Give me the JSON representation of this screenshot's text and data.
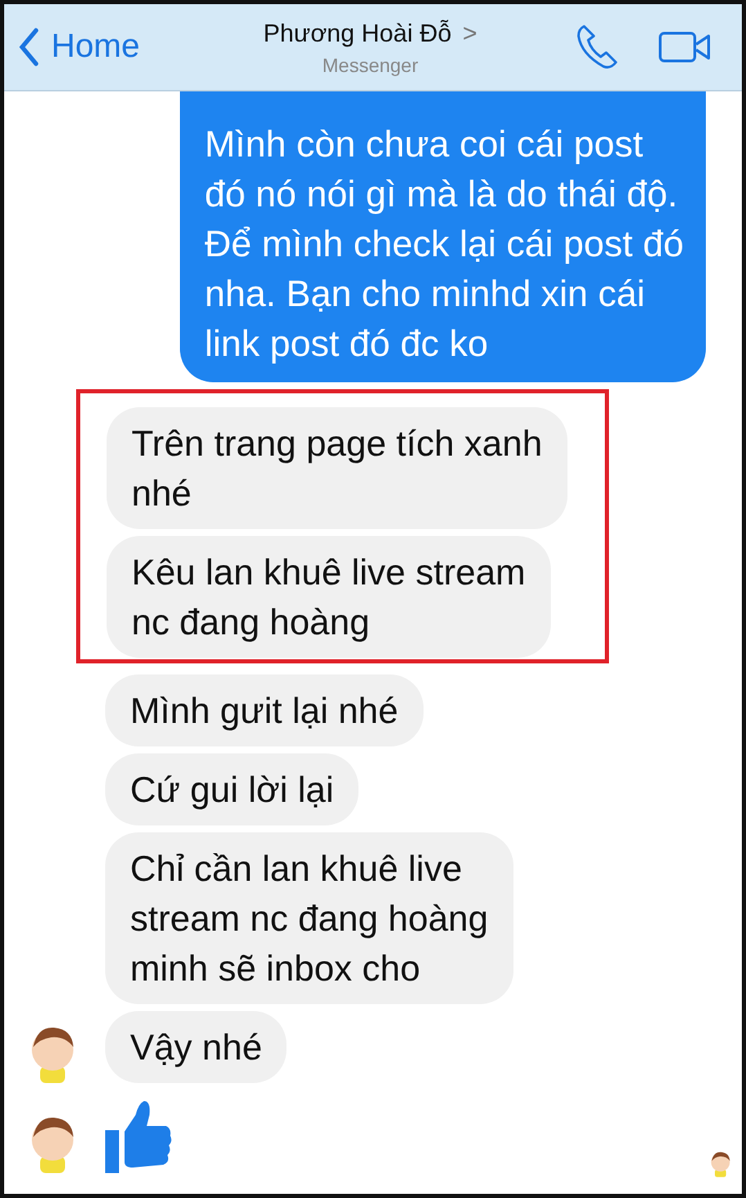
{
  "header": {
    "back": "Home",
    "title": "Phương Hoài Đỗ",
    "title_chevron": ">",
    "subtitle": "Messenger"
  },
  "messages": [
    {
      "kind": "sent",
      "lines": [
        "Mình còn chưa coi cái post",
        "đó nó nói gì mà là do thái độ.",
        "Để mình check lại cái post đó",
        "nha. Bạn cho minhd xin cái",
        "link post đó đc ko"
      ],
      "highlighted": false,
      "avatar": false
    },
    {
      "kind": "received",
      "lines": [
        "Trên trang page tích xanh",
        "nhé"
      ],
      "highlighted": true,
      "avatar": false
    },
    {
      "kind": "received",
      "lines": [
        "Kêu lan khuê live stream",
        "nc đang hoàng"
      ],
      "highlighted": true,
      "avatar": false
    },
    {
      "kind": "received",
      "lines": [
        "Mình gưit lại nhé"
      ],
      "highlighted": false,
      "avatar": false
    },
    {
      "kind": "received",
      "lines": [
        "Cứ gui lời lại"
      ],
      "highlighted": false,
      "avatar": false
    },
    {
      "kind": "received",
      "lines": [
        "Chỉ cần lan khuê live",
        "stream nc đang hoàng",
        "minh sẽ inbox cho"
      ],
      "highlighted": false,
      "avatar": false
    },
    {
      "kind": "received",
      "lines": [
        "Vậy nhé"
      ],
      "highlighted": false,
      "avatar": true
    },
    {
      "kind": "like",
      "highlighted": false,
      "avatar": true
    }
  ],
  "seen": true
}
